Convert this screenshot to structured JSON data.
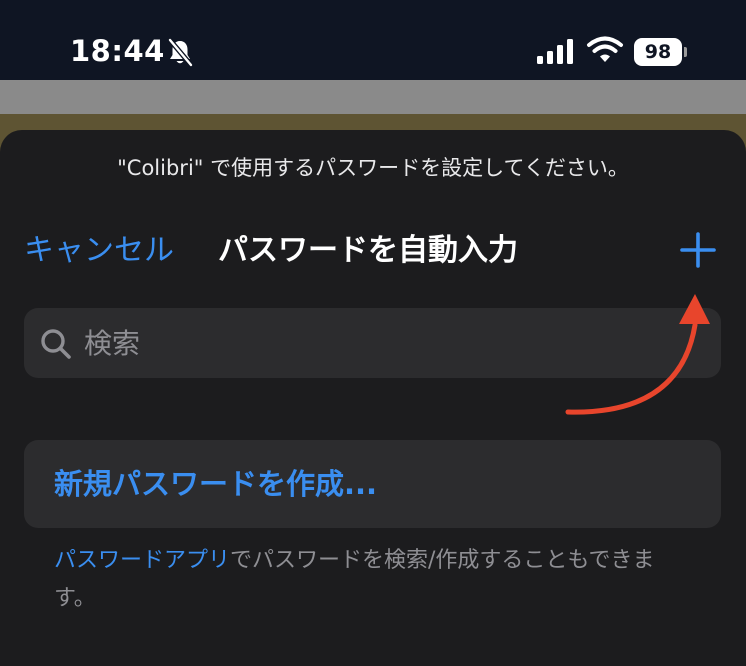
{
  "status_bar": {
    "time": "18:44",
    "battery_level": "98"
  },
  "sheet": {
    "prompt": "\"Colibri\" で使用するパスワードを設定してください。",
    "cancel_label": "キャンセル",
    "title": "パスワードを自動入力",
    "add_label": "+",
    "search": {
      "placeholder": "検索",
      "value": ""
    },
    "create_new_label": "新規パスワードを作成...",
    "footer": {
      "link_text": "パスワードアプリ",
      "rest_text": "でパスワードを検索/作成することもできます。"
    }
  },
  "colors": {
    "accent": "#3a8ef0",
    "annotation_arrow": "#e8452c",
    "sheet_background": "#1c1c1e",
    "field_background": "#2c2c2e"
  },
  "icons": {
    "bell": "bell-slash-icon",
    "signal": "cellular-signal-icon",
    "wifi": "wifi-icon",
    "search": "magnifying-glass-icon",
    "add": "plus-icon"
  }
}
